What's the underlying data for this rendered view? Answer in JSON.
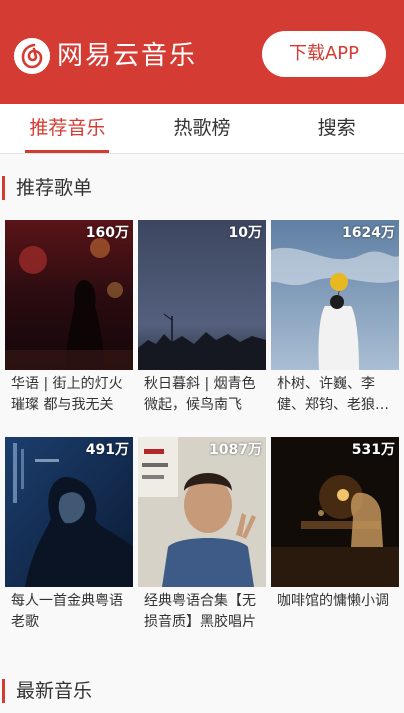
{
  "header": {
    "brand": "网易云音乐",
    "download_label": "下载APP",
    "logo_icon": "netease-music-icon",
    "bg_color": "#d43c33"
  },
  "tabs": [
    {
      "label": "推荐音乐",
      "active": true
    },
    {
      "label": "热歌榜",
      "active": false
    },
    {
      "label": "搜索",
      "active": false
    }
  ],
  "recommended": {
    "title": "推荐歌单",
    "playlists": [
      {
        "count": "160万",
        "title": "华语 | 街上的灯火璀璨 都与我无关"
      },
      {
        "count": "10万",
        "title": "秋日暮斜 | 烟青色微起，候鸟南飞"
      },
      {
        "count": "1624万",
        "title": "朴树、许巍、李健、郑钧、老狼、赵雷"
      },
      {
        "count": "491万",
        "title": "每人一首金典粤语老歌"
      },
      {
        "count": "1087万",
        "title": "经典粤语合集【无损音质】黑胶唱片"
      },
      {
        "count": "531万",
        "title": "咖啡馆的慵懒小调"
      }
    ]
  },
  "latest": {
    "title": "最新音乐"
  }
}
